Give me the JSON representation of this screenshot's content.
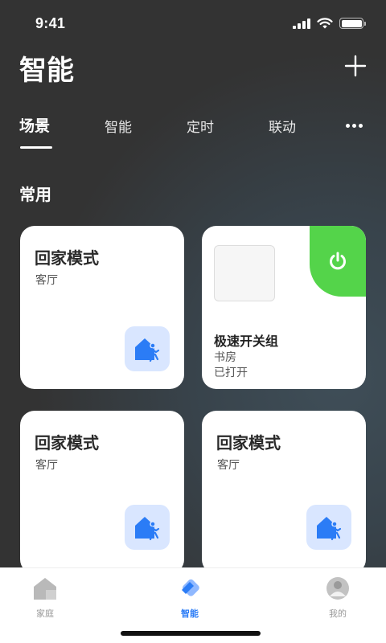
{
  "status": {
    "time": "9:41"
  },
  "header": {
    "title": "智能"
  },
  "tabs": [
    {
      "label": "场景",
      "active": true
    },
    {
      "label": "智能",
      "active": false
    },
    {
      "label": "定时",
      "active": false
    },
    {
      "label": "联动",
      "active": false
    }
  ],
  "section": {
    "title": "常用"
  },
  "scenes": [
    {
      "title": "回家模式",
      "room": "客厅",
      "icon": "home-walk-icon"
    },
    {
      "title": "回家模式",
      "room": "客厅",
      "icon": "home-walk-icon"
    },
    {
      "title": "回家模式",
      "room": "客厅",
      "icon": "home-walk-icon"
    }
  ],
  "switch_card": {
    "title": "极速开关组",
    "room": "书房",
    "state": "已打开",
    "icon": "power-icon",
    "accent": "#54d44a"
  },
  "nav": [
    {
      "label": "家庭",
      "icon": "house-icon",
      "active": false
    },
    {
      "label": "智能",
      "icon": "smart-icon",
      "active": true
    },
    {
      "label": "我的",
      "icon": "profile-icon",
      "active": false
    }
  ],
  "colors": {
    "accent_blue": "#2b7cf6",
    "icon_bg": "#d9e6ff",
    "background": "#333333"
  }
}
